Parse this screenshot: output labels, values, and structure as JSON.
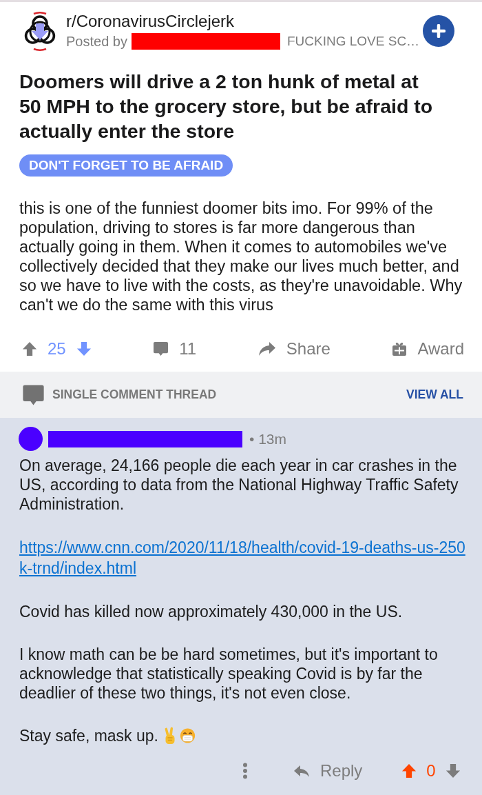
{
  "post": {
    "subreddit": "r/CoronavirusCirclejerk",
    "posted_by_label": "Posted by",
    "author_flair": "FUCKING LOVE SC…",
    "title": "Doomers will drive a 2 ton hunk of metal at 50 MPH to the grocery store, but be afraid to actually enter the store",
    "flair": "DON'T FORGET TO BE AFRAID",
    "body": "this is one of the funniest doomer bits imo. For 99% of the population, driving to stores is far more dangerous than actually going in them. When it comes to automobiles we've collectively decided that they make our lives much better, and so we have to live with the costs, as they're unavoidable. Why can't we do the same with this virus",
    "score": "25",
    "upvoted": false,
    "downvoted": true,
    "comments": "11",
    "share": "Share",
    "award": "Award"
  },
  "thread_bar": {
    "label": "SINGLE COMMENT THREAD",
    "action": "VIEW ALL"
  },
  "comment": {
    "age": "• 13m",
    "paragraphs": [
      {
        "kind": "text",
        "text": "On average, 24,166 people die each year in car crashes in the US, according to data from the National Highway Traffic Safety Administration."
      },
      {
        "kind": "link",
        "text": "https://www.cnn.com/2020/11/18/health/covid-19-deaths-us-250k-trnd/index.html"
      },
      {
        "kind": "text",
        "text": "Covid has killed now approximately 430,000 in the US."
      },
      {
        "kind": "text",
        "text": "I know math can be be hard sometimes, but it's important to acknowledge that statistically speaking Covid is by far the deadlier of these two things, it's not even close."
      },
      {
        "kind": "text_with_emoji",
        "text": "Stay safe, mask up."
      }
    ],
    "reply": "Reply",
    "score": "0",
    "upvoted": true,
    "downvoted": false
  }
}
